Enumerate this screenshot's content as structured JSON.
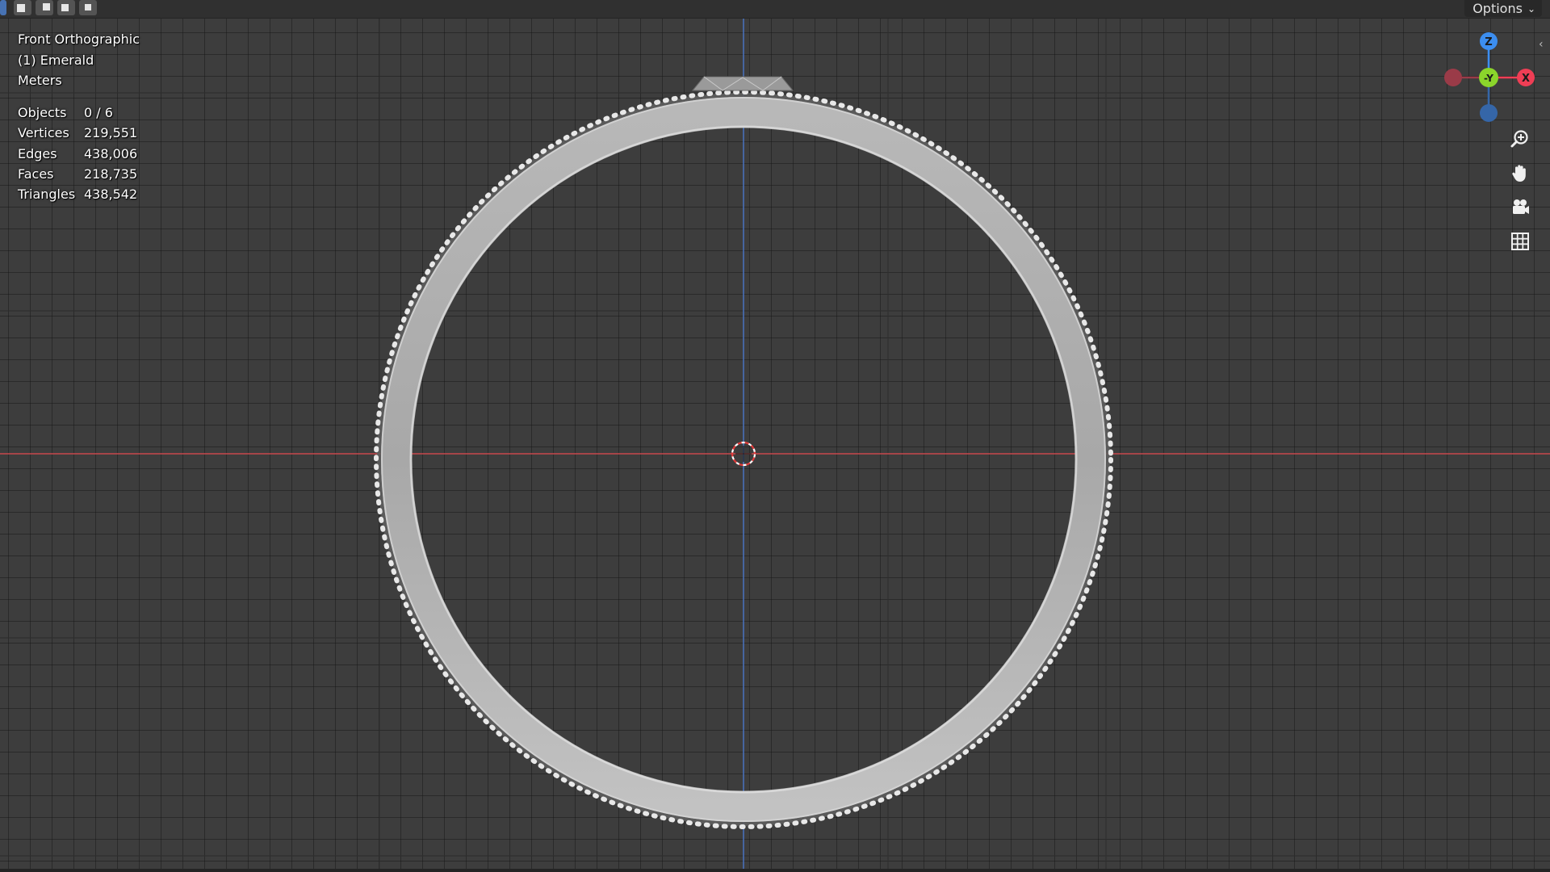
{
  "header": {
    "options_label": "Options",
    "mode_buttons": [
      "select-box",
      "extend",
      "subtract",
      "intersect"
    ]
  },
  "viewport": {
    "view_name": "Front Orthographic",
    "object_name": "(1) Emerald",
    "units": "Meters",
    "stats": [
      {
        "label": "Objects",
        "value": "0 / 6"
      },
      {
        "label": "Vertices",
        "value": "219,551"
      },
      {
        "label": "Edges",
        "value": "438,006"
      },
      {
        "label": "Faces",
        "value": "218,735"
      },
      {
        "label": "Triangles",
        "value": "438,542"
      }
    ]
  },
  "gizmo": {
    "z_label": "Z",
    "y_label": "-Y",
    "x_label": "X",
    "colors": {
      "x": "#ef3e55",
      "y": "#8bd52b",
      "z": "#3c8ef0",
      "x_neg": "#9a3b48",
      "z_neg": "#3566a8"
    }
  },
  "nav_tools": [
    "zoom-icon",
    "pan-hand-icon",
    "camera-icon",
    "grid-icon"
  ],
  "colors": {
    "background": "#3d3d3d",
    "x_axis": "#c8484d",
    "z_axis": "#4a73c0"
  }
}
